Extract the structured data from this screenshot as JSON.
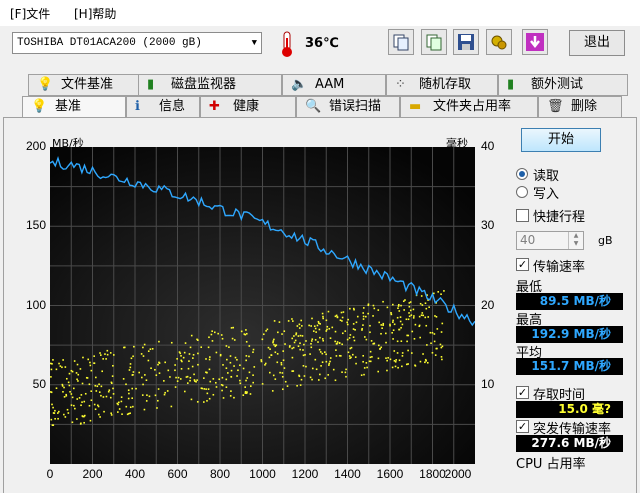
{
  "menu": {
    "file": "[F]文件",
    "help": "[H]帮助"
  },
  "toolbar": {
    "drive": "TOSHIBA DT01ACA200 (2000 gB)",
    "temperature": "36℃",
    "exit": "退出",
    "icons": [
      "copy-icon",
      "copy-all-icon",
      "save-icon",
      "options-icon",
      "download-icon"
    ]
  },
  "tabs_top": [
    {
      "label": "文件基准",
      "icon": "info-bulb-icon"
    },
    {
      "label": "磁盘监视器",
      "icon": "bar-chart-icon"
    },
    {
      "label": "AAM",
      "icon": "speaker-icon"
    },
    {
      "label": "随机存取",
      "icon": "scatter-icon"
    },
    {
      "label": "额外测试",
      "icon": "bar-chart-icon"
    }
  ],
  "tabs_bottom": [
    {
      "label": "基准",
      "icon": "bulb-icon",
      "active": true
    },
    {
      "label": "信息",
      "icon": "info-icon"
    },
    {
      "label": "健康",
      "icon": "health-cross-icon"
    },
    {
      "label": "错误扫描",
      "icon": "magnifier-icon"
    },
    {
      "label": "文件夹占用率",
      "icon": "folder-icon"
    },
    {
      "label": "删除",
      "icon": "trash-icon"
    }
  ],
  "controls": {
    "start": "开始",
    "read": "读取",
    "write": "写入",
    "read_selected": true,
    "short_stroke": "快捷行程",
    "short_stroke_value": "40",
    "short_stroke_unit": "gB",
    "transfer_rate": "传输速率",
    "min_label": "最低",
    "min_value": "89.5 MB/秒",
    "max_label": "最高",
    "max_value": "192.9 MB/秒",
    "avg_label": "平均",
    "avg_value": "151.7 MB/秒",
    "access_time": "存取时间",
    "access_value": "15.0 毫?",
    "burst_rate": "突发传输速率",
    "burst_value": "277.6 MB/秒",
    "cpu_usage": "CPU 占用率"
  },
  "chart_data": {
    "type": "line",
    "ylabel_left": "MB/秒",
    "ylabel_right": "毫秒",
    "y_left_ticks": [
      200,
      150,
      100,
      50
    ],
    "y_right_ticks": [
      40,
      30,
      20,
      10
    ],
    "x_ticks": [
      0,
      200,
      400,
      600,
      800,
      1000,
      1200,
      1400,
      1600,
      1800,
      2000
    ],
    "xlim": [
      0,
      2000
    ],
    "ylim_left": [
      0,
      200
    ],
    "ylim_right": [
      0,
      40
    ],
    "grid": true,
    "transfer_series": {
      "name": "传输速率",
      "color": "#2fa8ff",
      "x": [
        0,
        100,
        200,
        300,
        400,
        500,
        600,
        700,
        800,
        900,
        1000,
        1100,
        1200,
        1300,
        1400,
        1500,
        1600,
        1700,
        1800,
        1900,
        2000
      ],
      "y": [
        190,
        189,
        185,
        181,
        178,
        174,
        170,
        166,
        161,
        157,
        152,
        147,
        141,
        135,
        129,
        123,
        117,
        111,
        104,
        97,
        90
      ]
    },
    "access_series": {
      "name": "存取时间",
      "color": "#ffff30",
      "x_range": [
        0,
        1850
      ],
      "y_range_ms": [
        5,
        24
      ]
    }
  }
}
